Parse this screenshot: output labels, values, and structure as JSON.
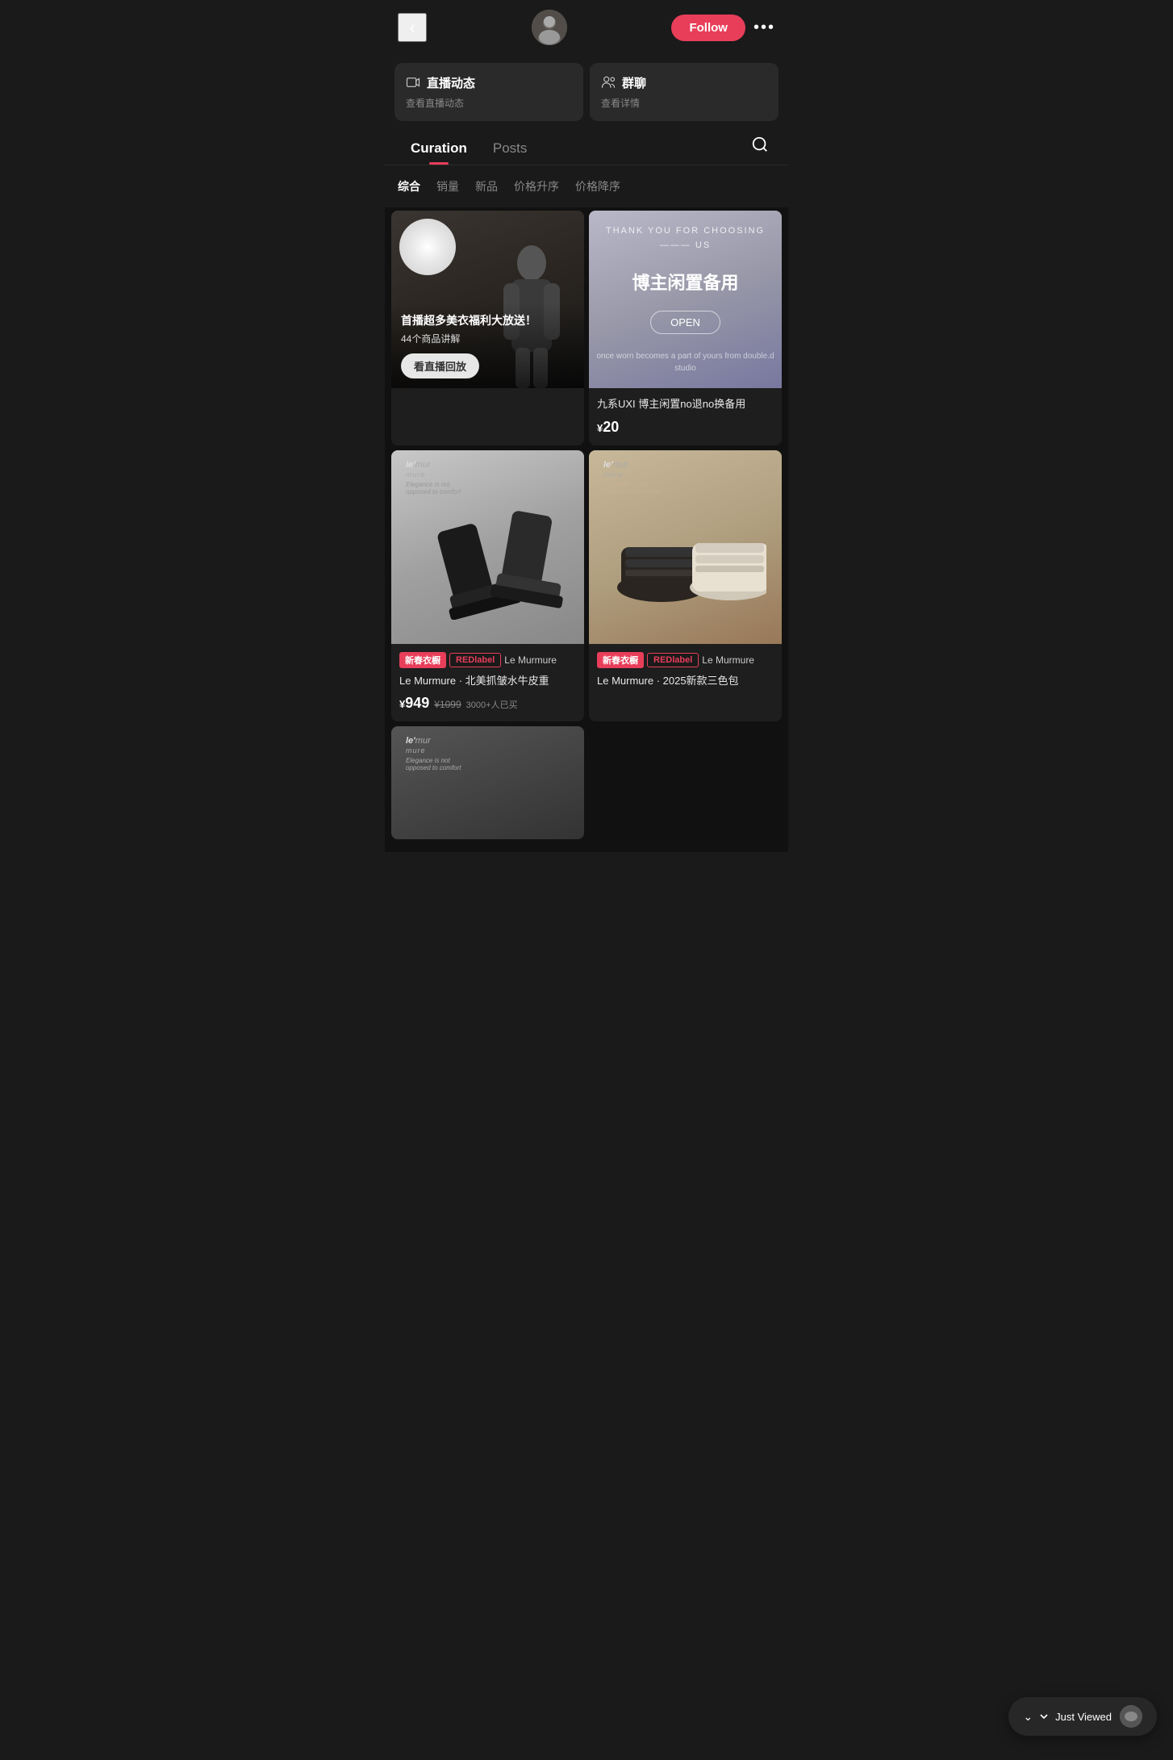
{
  "header": {
    "back_label": "‹",
    "follow_label": "Follow",
    "more_label": "•••",
    "avatar_alt": "User Avatar"
  },
  "info_cards": {
    "live": {
      "title": "直播动态",
      "subtitle": "查看直播动态",
      "icon": "📺"
    },
    "group": {
      "title": "群聊",
      "subtitle": "查看详情",
      "icon": "👥"
    }
  },
  "tabs": {
    "items": [
      {
        "id": "curation",
        "label": "Curation",
        "active": true
      },
      {
        "id": "posts",
        "label": "Posts",
        "active": false
      }
    ],
    "search_icon": "search"
  },
  "filters": {
    "items": [
      {
        "id": "overall",
        "label": "综合",
        "active": true
      },
      {
        "id": "sales",
        "label": "销量",
        "active": false
      },
      {
        "id": "new",
        "label": "新品",
        "active": false
      },
      {
        "id": "price-asc",
        "label": "价格升序",
        "active": false
      },
      {
        "id": "price-desc",
        "label": "价格降序",
        "active": false
      }
    ]
  },
  "products": [
    {
      "id": "live-card",
      "type": "live",
      "title": "首播超多美衣福利大放送！",
      "subtitle": "44个商品讲解",
      "button_label": "看直播回放"
    },
    {
      "id": "store-card",
      "type": "store",
      "thank_text": "THANK   YOU   FOR\nCHOOSING ——— US",
      "title_cn": "博主闲置备用",
      "open_label": "OPEN",
      "slogan": "once worn becomes a part of yours\nfrom double.d studio",
      "name": "九系UXI 博主闲置no退no换备用",
      "price": "20",
      "price_currency": "¥"
    },
    {
      "id": "boots-card",
      "type": "product",
      "tags": [
        {
          "label": "新春衣橱",
          "style": "new"
        },
        {
          "label": "REDlabel",
          "style": "red"
        }
      ],
      "brand": "Le Murmure",
      "name": "北美抓皱水牛皮重",
      "price": "949",
      "price_currency": "¥",
      "price_original": "¥1099",
      "sold_count": "3000+人已买",
      "logo": "le'mur mure"
    },
    {
      "id": "shoes-card",
      "type": "product",
      "tags": [
        {
          "label": "新春衣橱",
          "style": "new"
        },
        {
          "label": "REDlabel",
          "style": "red"
        }
      ],
      "brand": "Le Murmure",
      "name": "2025新款三色包",
      "price": "",
      "price_currency": "",
      "logo": "le'mur mure"
    },
    {
      "id": "bottom-card",
      "type": "bottom",
      "logo": "le'mur mure"
    }
  ],
  "just_viewed": {
    "label": "Just Viewed"
  },
  "colors": {
    "accent": "#e83e5a",
    "bg": "#1a1a1a",
    "card_bg": "#2a2a2a"
  }
}
